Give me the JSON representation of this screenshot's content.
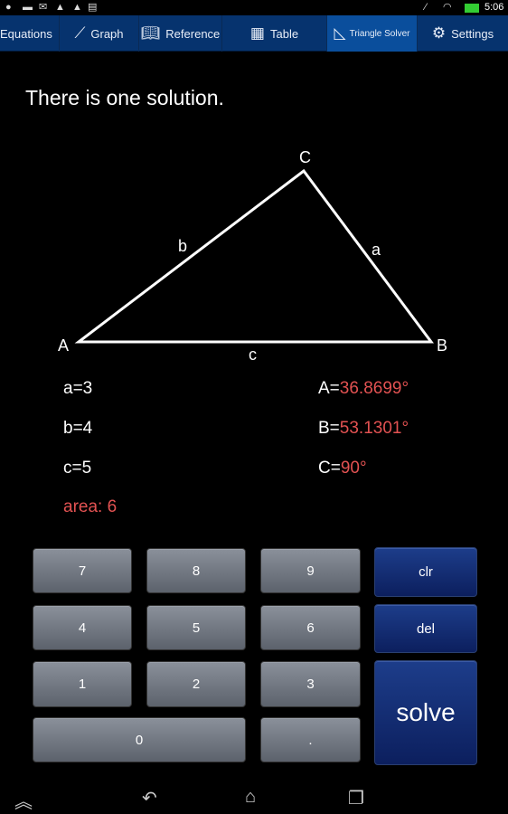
{
  "status_bar": {
    "time": "5:06",
    "left_icons": [
      "hangouts-icon",
      "gallery-icon",
      "gmail-icon",
      "warning-icon",
      "warning-icon",
      "clipboard-icon"
    ],
    "right_icons": [
      "no-signal-icon",
      "wifi-icon",
      "battery-icon"
    ]
  },
  "tabs": [
    {
      "label": "Equations",
      "icon": ""
    },
    {
      "label": "Graph",
      "icon": "graph-icon"
    },
    {
      "label": "Reference",
      "icon": "book-icon"
    },
    {
      "label": "Table",
      "icon": "table-icon"
    },
    {
      "label": "Triangle Solver",
      "icon": "triangle-icon",
      "selected": true
    },
    {
      "label": "Settings",
      "icon": "gear-icon"
    }
  ],
  "message": "There is one solution.",
  "triangle": {
    "vertices": {
      "A": "A",
      "B": "B",
      "C": "C"
    },
    "sides": {
      "a": "a",
      "b": "b",
      "c": "c"
    }
  },
  "results": {
    "sides": [
      {
        "label": "a=",
        "value": "3"
      },
      {
        "label": "b=",
        "value": "4"
      },
      {
        "label": "c=",
        "value": "5"
      }
    ],
    "angles": [
      {
        "label": "A=",
        "value": "36.8699°"
      },
      {
        "label": "B=",
        "value": "53.1301°"
      },
      {
        "label": "C=",
        "value": "90°"
      }
    ],
    "area": "area: 6"
  },
  "keypad": {
    "keys": [
      "7",
      "8",
      "9",
      "4",
      "5",
      "6",
      "1",
      "2",
      "3",
      "0",
      "."
    ],
    "clr": "clr",
    "del": "del",
    "solve": "solve"
  },
  "colors": {
    "tab_bar": "#06336e",
    "tab_selected": "#0a4e9c",
    "result": "#e25252",
    "action_key": "#15307a"
  }
}
